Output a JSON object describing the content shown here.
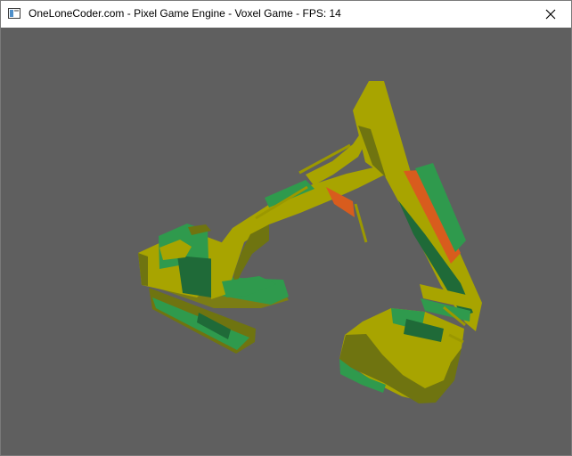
{
  "window": {
    "title": "OneLoneCoder.com - Pixel Game Engine - Voxel Game - FPS: 14",
    "app_icon": "window-app-icon",
    "close_icon": "close-icon"
  },
  "scene": {
    "background": "#5f5f5f",
    "subject": "excavator-voxel-model",
    "colors": {
      "yellow": "#a8a400",
      "olive": "#6f7410",
      "green": "#2f9a4d",
      "dark_green": "#1f6a38",
      "orange": "#d85c1d"
    }
  }
}
